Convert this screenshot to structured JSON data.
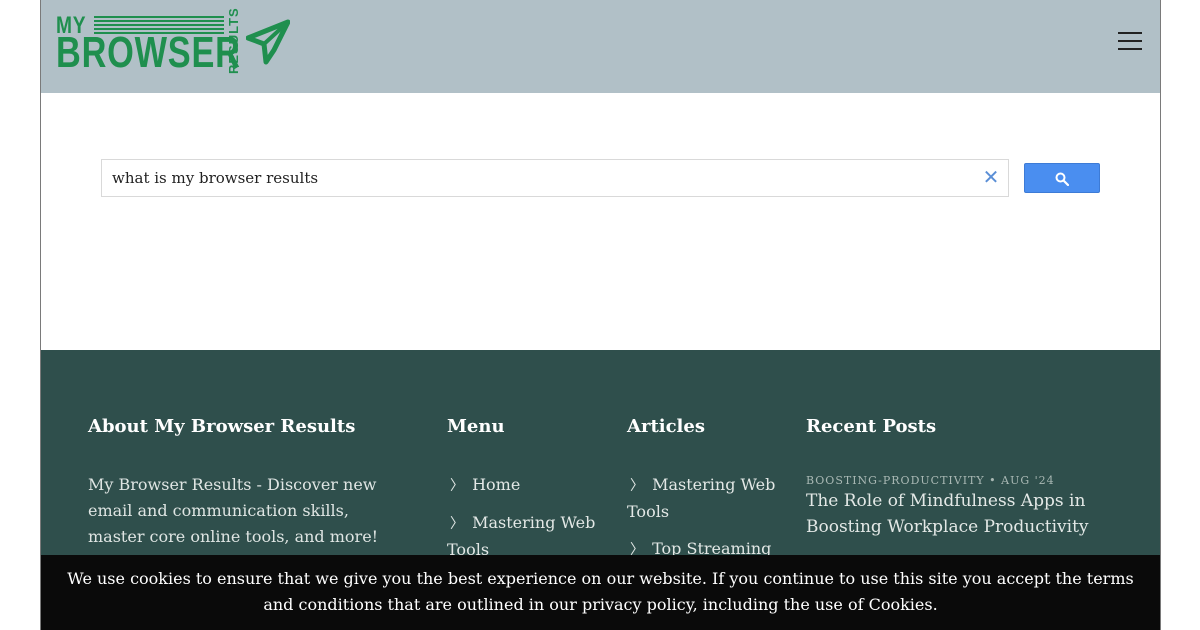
{
  "header": {
    "logo": {
      "line1": "MY",
      "line2": "BROWSER",
      "side": "RESULTS"
    },
    "menu_icon": "hamburger-icon"
  },
  "search": {
    "value": "what is my browser results",
    "clear_glyph": "✕",
    "button_icon": "search-icon",
    "button_color": "#4a8ef0"
  },
  "footer": {
    "about": {
      "title": "About My Browser Results",
      "text": "My Browser Results - Discover new email and communication skills, master core online tools, and more!"
    },
    "menu": {
      "title": "Menu",
      "items": [
        {
          "arrow": "〉",
          "label": "Home"
        },
        {
          "arrow": "〉",
          "label": "Mastering Web Tools"
        }
      ]
    },
    "articles": {
      "title": "Articles",
      "items": [
        {
          "arrow": "〉",
          "label": "Mastering Web Tools"
        },
        {
          "arrow": "〉",
          "label": "Top Streaming"
        }
      ]
    },
    "recent": {
      "title": "Recent Posts",
      "posts": [
        {
          "meta": "BOOSTING-PRODUCTIVITY • AUG '24",
          "title": "The Role of Mindfulness Apps in Boosting Workplace Productivity"
        }
      ]
    }
  },
  "cookie": {
    "text": "We use cookies to ensure that we give you the best experience on our website. If you continue to use this site you accept the terms and conditions that are outlined in our privacy policy, including the use of Cookies."
  },
  "colors": {
    "header_bg": "#b1c0c7",
    "brand_green": "#1f8f4e",
    "footer_bg": "#2f4f4c",
    "cookie_bg": "#0a0a0a"
  }
}
